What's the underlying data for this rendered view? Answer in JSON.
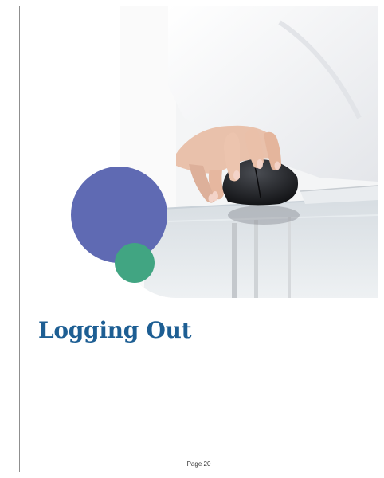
{
  "document": {
    "title": "Logging Out",
    "footer": "Page 20"
  },
  "hero_image": {
    "icon": "hand-on-mouse-photo"
  },
  "colors": {
    "title": "#1d5e93",
    "circle_large": "#5f6ab3",
    "circle_small": "#41a582"
  }
}
